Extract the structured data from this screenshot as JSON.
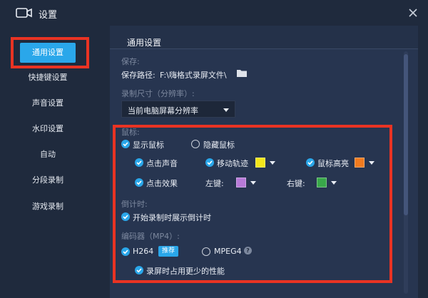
{
  "window": {
    "title": "设置",
    "camera_icon": "video-camera-icon",
    "close_icon": "close-icon"
  },
  "sidebar": {
    "items": [
      {
        "label": "通用设置",
        "active": true
      },
      {
        "label": "快捷键设置",
        "active": false
      },
      {
        "label": "声音设置",
        "active": false
      },
      {
        "label": "水印设置",
        "active": false
      },
      {
        "label": "自动",
        "active": false
      },
      {
        "label": "分段录制",
        "active": false
      },
      {
        "label": "游戏录制",
        "active": false
      }
    ]
  },
  "main": {
    "section_title": "通用设置",
    "save": {
      "label": "保存:",
      "path_label": "保存路径:",
      "path_value": "F:\\嗨格式录屏文件\\",
      "folder_icon": "folder-icon"
    },
    "record_size": {
      "label": "录制尺寸（分辨率）:",
      "selected": "当前电脑屏幕分辨率"
    },
    "mouse": {
      "label": "鼠标:",
      "show_cursor": "显示鼠标",
      "hide_cursor": "隐藏鼠标",
      "click_sound": "点击声音",
      "move_trail": "移动轨迹",
      "cursor_highlight": "鼠标高亮",
      "click_effect": "点击效果",
      "left_key": "左键:",
      "right_key": "右键:",
      "colors": {
        "move_trail": "#f5e61a",
        "cursor_highlight": "#f27b1f",
        "left_key": "#b77ad8",
        "right_key": "#39a84a"
      }
    },
    "countdown": {
      "label": "倒计时:",
      "option": "开始录制时展示倒计时"
    },
    "encoder": {
      "label": "编码器（MP4）:",
      "h264": "H264",
      "recommended": "推荐",
      "mpeg4": "MPEG4",
      "help": "?",
      "low_perf": "录屏时占用更少的性能"
    }
  },
  "colors": {
    "accent": "#2aa7ea",
    "highlight_box": "#e93323"
  }
}
